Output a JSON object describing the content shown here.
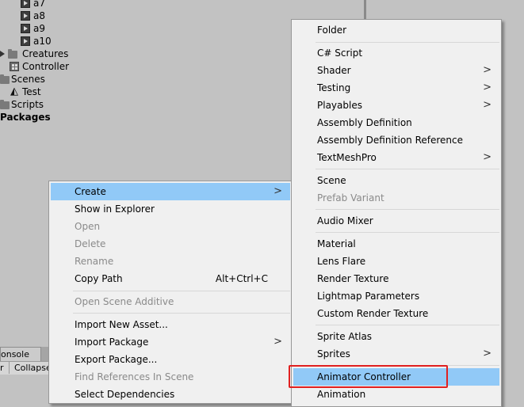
{
  "project_tree": {
    "items": [
      {
        "label": "a7",
        "icon": "animation-clip-icon"
      },
      {
        "label": "a8",
        "icon": "animation-clip-icon"
      },
      {
        "label": "a9",
        "icon": "animation-clip-icon"
      },
      {
        "label": "a10",
        "icon": "animation-clip-icon"
      },
      {
        "label": "Creatures",
        "icon": "folder-icon"
      },
      {
        "label": "Controller",
        "icon": "animator-controller-icon"
      },
      {
        "label": "Scenes",
        "icon": "folder-icon"
      },
      {
        "label": "Test",
        "icon": "unity-scene-icon"
      },
      {
        "label": "Scripts",
        "icon": "folder-icon"
      },
      {
        "label": "Packages",
        "icon": ""
      }
    ]
  },
  "console": {
    "tab_label": "onsole",
    "toolbar_clear": "r",
    "toolbar_collapse": "Collapse"
  },
  "context_menu": {
    "items": [
      {
        "label": "Create",
        "submenu": true,
        "highlighted": true
      },
      {
        "label": "Show in Explorer"
      },
      {
        "label": "Open",
        "disabled": true
      },
      {
        "label": "Delete",
        "disabled": true
      },
      {
        "label": "Rename",
        "disabled": true
      },
      {
        "label": "Copy Path",
        "shortcut": "Alt+Ctrl+C"
      },
      {
        "label": "Open Scene Additive",
        "disabled": true
      },
      {
        "label": "Import New Asset..."
      },
      {
        "label": "Import Package",
        "submenu": true
      },
      {
        "label": "Export Package..."
      },
      {
        "label": "Find References In Scene",
        "disabled": true
      },
      {
        "label": "Select Dependencies"
      }
    ]
  },
  "create_submenu": {
    "items": [
      {
        "label": "Folder"
      },
      {
        "label": "C# Script"
      },
      {
        "label": "Shader",
        "submenu": true
      },
      {
        "label": "Testing",
        "submenu": true
      },
      {
        "label": "Playables",
        "submenu": true
      },
      {
        "label": "Assembly Definition"
      },
      {
        "label": "Assembly Definition Reference"
      },
      {
        "label": "TextMeshPro",
        "submenu": true
      },
      {
        "label": "Scene"
      },
      {
        "label": "Prefab Variant",
        "disabled": true
      },
      {
        "label": "Audio Mixer"
      },
      {
        "label": "Material"
      },
      {
        "label": "Lens Flare"
      },
      {
        "label": "Render Texture"
      },
      {
        "label": "Lightmap Parameters"
      },
      {
        "label": "Custom Render Texture"
      },
      {
        "label": "Sprite Atlas"
      },
      {
        "label": "Sprites",
        "submenu": true
      },
      {
        "label": "Animator Controller",
        "highlighted": true,
        "annotated": true
      },
      {
        "label": "Animation"
      }
    ]
  },
  "submenu_arrow_glyph": ">",
  "colors": {
    "highlight": "#91c9f7",
    "annotation": "#e02020",
    "menu_bg": "#f0f0f0",
    "background": "#c2c2c2"
  }
}
